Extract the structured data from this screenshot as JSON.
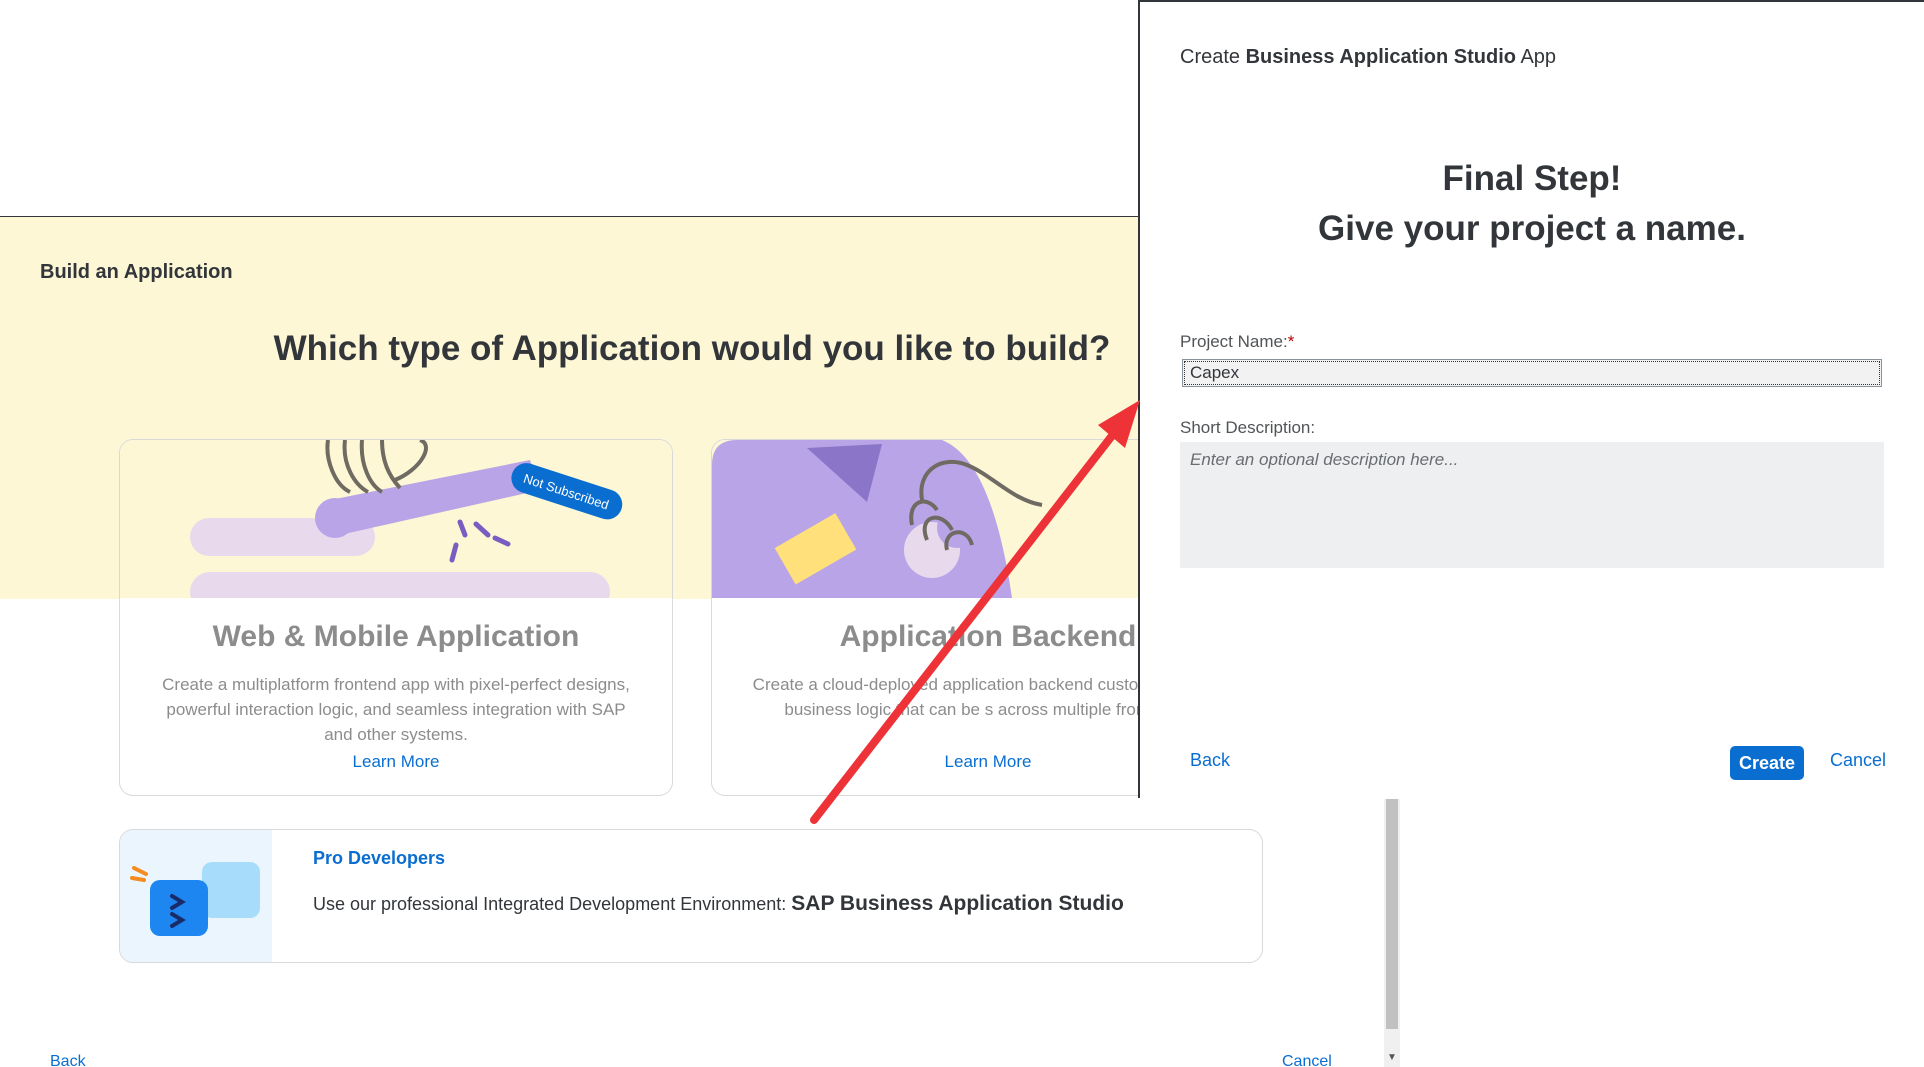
{
  "background_panel": {
    "title": "Build an Application",
    "headline": "Which type of Application would you like to build?",
    "cards": [
      {
        "title": "Web & Mobile Application",
        "description": "Create a multiplatform frontend app with pixel-perfect designs, powerful interaction logic, and seamless integration with SAP and other systems.",
        "link": "Learn More",
        "badge": "Not Subscribed"
      },
      {
        "title": "Application Backend",
        "description": "Create a cloud-deployed application backend custom data and business logic that can be s across multiple frontends.",
        "link": "Learn More"
      }
    ],
    "pro": {
      "title": "Pro Developers",
      "text": "Use our professional Integrated Development Environment: ",
      "strong": "SAP Business Application Studio"
    },
    "back_label": "Back",
    "cancel_label": "Cancel"
  },
  "dialog": {
    "header_prefix": "Create ",
    "header_strong": "Business Application Studio",
    "header_suffix": " App",
    "step_line1": "Final Step!",
    "step_line2": "Give your project a name.",
    "project_name_label": "Project Name:",
    "required_mark": "*",
    "project_name_value": "Capex",
    "description_label": "Short Description:",
    "description_placeholder": "Enter an optional description here...",
    "back_label": "Back",
    "create_label": "Create",
    "cancel_label": "Cancel"
  },
  "colors": {
    "accent": "#0a6ed1",
    "annotation_arrow": "#ee3338",
    "yellow_band": "#fdf7d5",
    "illustration_purple": "#b9a4e8"
  },
  "icons": [
    "ide-icon",
    "annotation-arrow",
    "scroll-down-arrow-icon"
  ]
}
